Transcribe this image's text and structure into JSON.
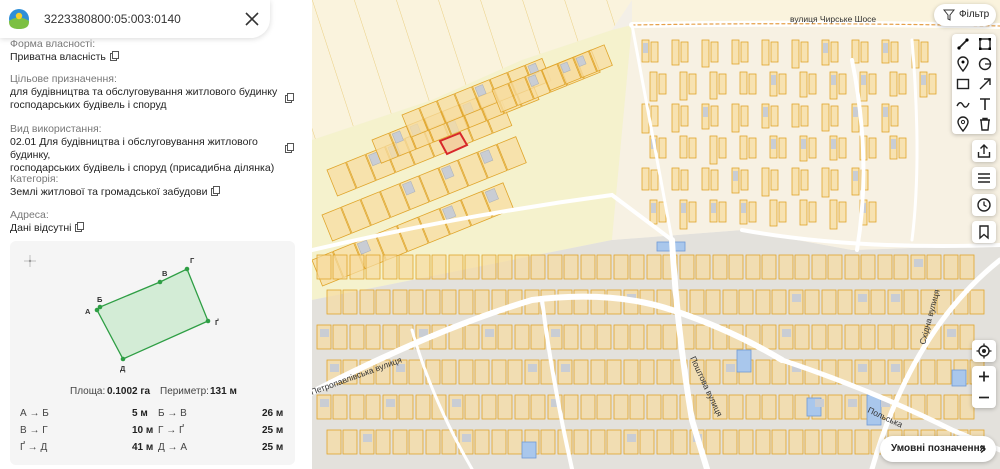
{
  "search": {
    "cadastral_number": "3223380800:05:003:0140"
  },
  "fields": [
    {
      "label": "Форма власності:",
      "value": "Приватна власність"
    },
    {
      "label": "Цільове призначення:",
      "value_lines": [
        "для будівництва та обслуговування житлового будинку",
        "господарських будівель і споруд"
      ]
    },
    {
      "label": "Вид використання:",
      "value_lines": [
        "02.01 Для будівництва і обслуговування житлового будинку,",
        "господарських будівель і споруд (присадибна ділянка)"
      ]
    },
    {
      "label": "Категорія:",
      "value": "Землі житлової та громадської забудови"
    },
    {
      "label": "Адреса:",
      "value": "Дані відсутні"
    }
  ],
  "shape": {
    "vertices": [
      "А",
      "Б",
      "В",
      "Г",
      "Ґ",
      "Д"
    ],
    "accent_color": "#2e9e44",
    "fill_color": "#d3ecd6"
  },
  "summary": {
    "area_label": "Площа:",
    "area_value": "0.1002 га",
    "perimeter_label": "Периметр:",
    "perimeter_value": "131 м"
  },
  "segments": [
    {
      "label": "А → Б",
      "value": "5 м"
    },
    {
      "label": "Б → В",
      "value": "26 м"
    },
    {
      "label": "В → Г",
      "value": "10 м"
    },
    {
      "label": "Г → Ґ",
      "value": "25 м"
    },
    {
      "label": "Ґ → Д",
      "value": "41 м"
    },
    {
      "label": "Д → А",
      "value": "25 м"
    }
  ],
  "map": {
    "filter_label": "Фільтр",
    "legend_label": "Умовні позначення",
    "streets": [
      "вулиця Чирське Шосе",
      "Петропавлівська вулиця",
      "Поштова вулиця",
      "Польська",
      "Східна вулиця"
    ],
    "parcel_fill": "#f7dca0",
    "parcel_stroke": "#e0a52b",
    "selected_stroke": "#d8282a",
    "building_fill": "#c9cdd4"
  }
}
